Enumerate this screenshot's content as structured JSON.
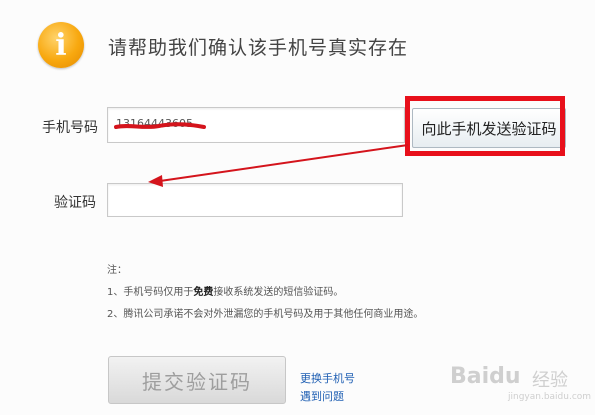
{
  "header": {
    "icon_glyph": "i",
    "title": "请帮助我们确认该手机号真实存在"
  },
  "form": {
    "phone_label": "手机号码",
    "phone_value": "13164443605",
    "send_button": "向此手机发送验证码",
    "code_label": "验证码",
    "code_value": ""
  },
  "notes": {
    "heading": "注：",
    "line1_prefix": "1、手机号码仅用于",
    "line1_bold": "免费",
    "line1_suffix": "接收系统发送的短信验证码。",
    "line2": "2、腾讯公司承诺不会对外泄漏您的手机号码及用于其他任何商业用途。"
  },
  "actions": {
    "submit_button": "提交验证码",
    "change_phone_link": "更换手机号",
    "problem_link": "遇到问题"
  },
  "watermark": {
    "brand": "Baidu",
    "jingyan": "经验",
    "url": "jingyan.baidu.com"
  },
  "annotation": {
    "highlight_color": "#e8101b"
  }
}
